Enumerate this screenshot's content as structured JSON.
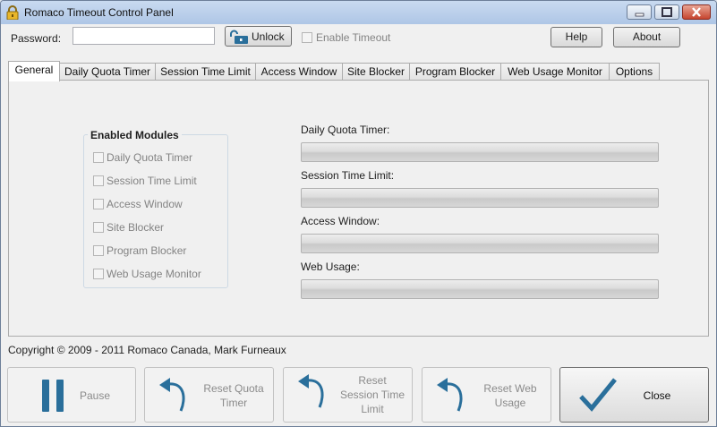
{
  "window": {
    "title": "Romaco Timeout Control Panel"
  },
  "header": {
    "password_label": "Password:",
    "password_value": "",
    "unlock_label": "Unlock",
    "enable_timeout_label": "Enable Timeout",
    "help_label": "Help",
    "about_label": "About"
  },
  "tabs": [
    {
      "label": "General",
      "active": true
    },
    {
      "label": "Daily Quota Timer"
    },
    {
      "label": "Session Time Limit"
    },
    {
      "label": "Access Window"
    },
    {
      "label": "Site Blocker"
    },
    {
      "label": "Program Blocker"
    },
    {
      "label": "Web Usage Monitor"
    },
    {
      "label": "Options"
    }
  ],
  "general": {
    "enabled_modules_title": "Enabled Modules",
    "modules": [
      {
        "label": "Daily Quota Timer",
        "checked": false
      },
      {
        "label": "Session Time Limit",
        "checked": false
      },
      {
        "label": "Access Window",
        "checked": false
      },
      {
        "label": "Site Blocker",
        "checked": false
      },
      {
        "label": "Program Blocker",
        "checked": false
      },
      {
        "label": "Web Usage Monitor",
        "checked": false
      }
    ],
    "progress": [
      {
        "label": "Daily Quota Timer:",
        "value": 0
      },
      {
        "label": "Session Time Limit:",
        "value": 0
      },
      {
        "label": "Access Window:",
        "value": 0
      },
      {
        "label": "Web Usage:",
        "value": 0
      }
    ]
  },
  "footer": {
    "copyright": "Copyright © 2009 - 2011 Romaco Canada, Mark Furneaux",
    "pause_label": "Pause",
    "reset_quota_label": [
      "Reset Quota",
      "Timer"
    ],
    "reset_session_label": [
      "Reset",
      "Session Time",
      "Limit"
    ],
    "reset_web_label": [
      "Reset Web",
      "Usage"
    ],
    "close_label": "Close"
  },
  "colors": {
    "accent": "#2a6f9b",
    "titlebar": "#b9cfea",
    "close_red": "#c6452f"
  }
}
